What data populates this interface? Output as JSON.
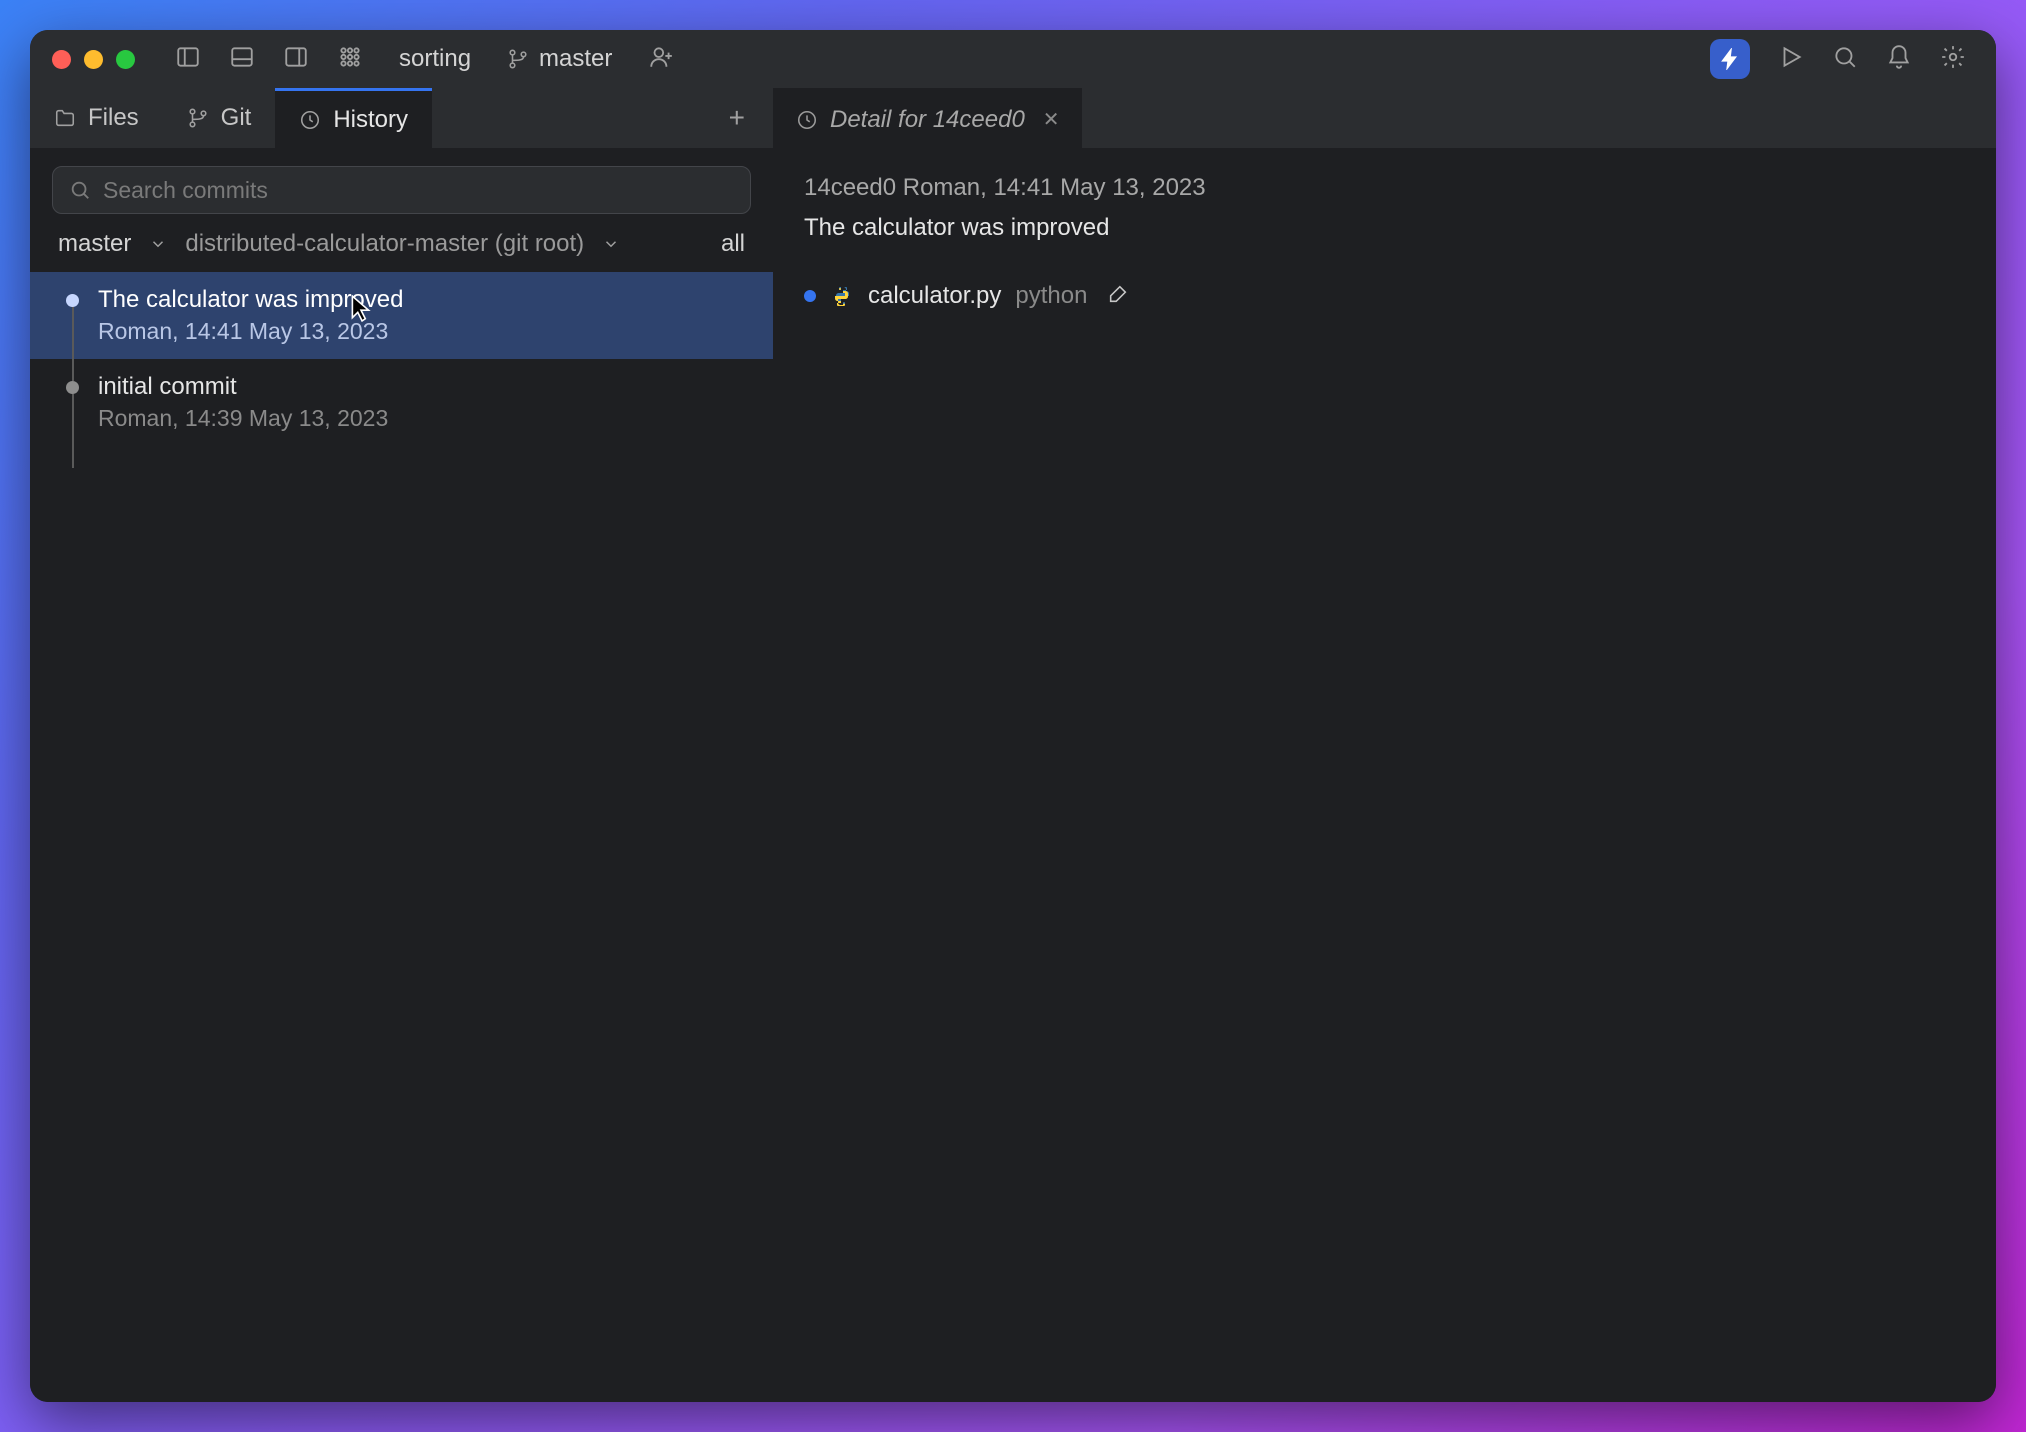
{
  "titlebar": {
    "project": "sorting",
    "branch": "master"
  },
  "sidebar_tabs": {
    "files": "Files",
    "git": "Git",
    "history": "History"
  },
  "search": {
    "placeholder": "Search commits"
  },
  "filters": {
    "branch": "master",
    "root": "distributed-calculator-master (git root)",
    "scope": "all"
  },
  "commits": [
    {
      "title": "The calculator was improved",
      "meta": "Roman, 14:41 May 13, 2023",
      "selected": true
    },
    {
      "title": "initial commit",
      "meta": "Roman, 14:39 May 13, 2023",
      "selected": false
    }
  ],
  "detail": {
    "tab_title": "Detail for 14ceed0",
    "header": "14ceed0 Roman, 14:41 May 13, 2023",
    "message": "The calculator was improved",
    "file": {
      "name": "calculator.py",
      "dir": "python"
    }
  }
}
